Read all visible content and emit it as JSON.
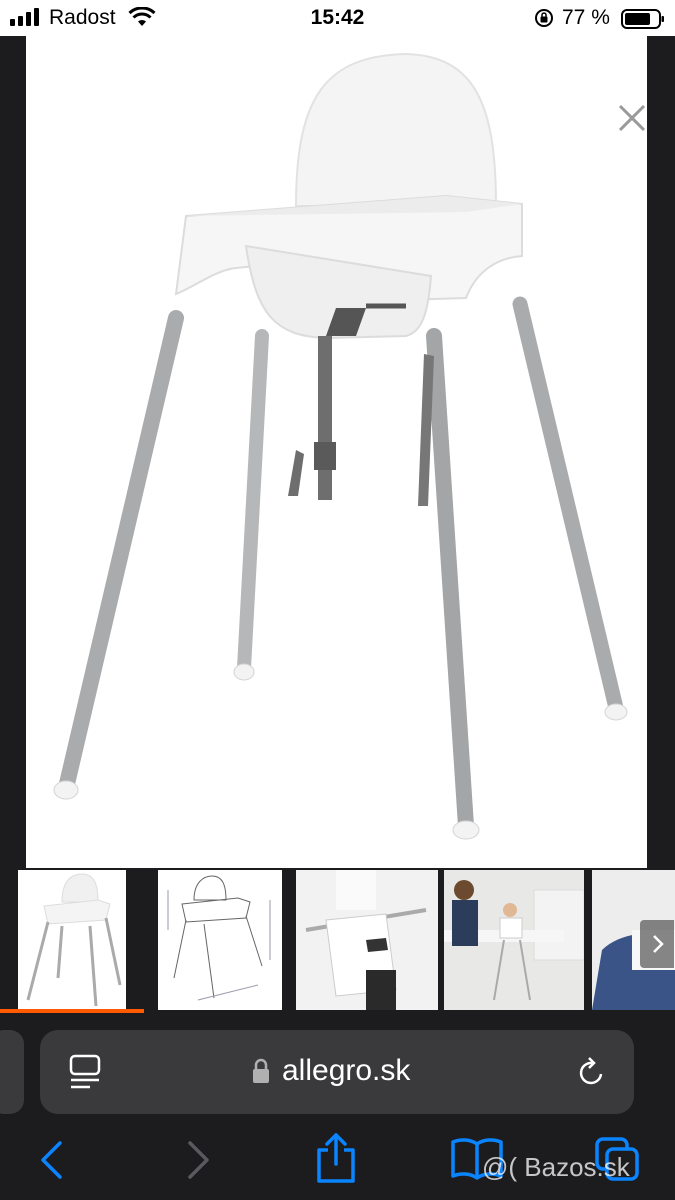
{
  "status_bar": {
    "carrier": "Radost",
    "time": "15:42",
    "battery_percent": "77 %"
  },
  "viewer": {
    "close_icon": "close-icon"
  },
  "thumbnails": [
    {
      "name": "highchair-front"
    },
    {
      "name": "highchair-dimensions-drawing"
    },
    {
      "name": "tray-removal-photo"
    },
    {
      "name": "family-dining-photo"
    },
    {
      "name": "child-in-chair-photo"
    }
  ],
  "address_bar": {
    "url": "allegro.sk"
  },
  "toolbar": {
    "icons": [
      "back-icon",
      "forward-icon",
      "share-icon",
      "bookmarks-icon",
      "tabs-icon"
    ]
  },
  "watermark": "@( Bazos.sk",
  "colors": {
    "accent": "#0a84ff",
    "active_thumb": "#ff5a00"
  }
}
